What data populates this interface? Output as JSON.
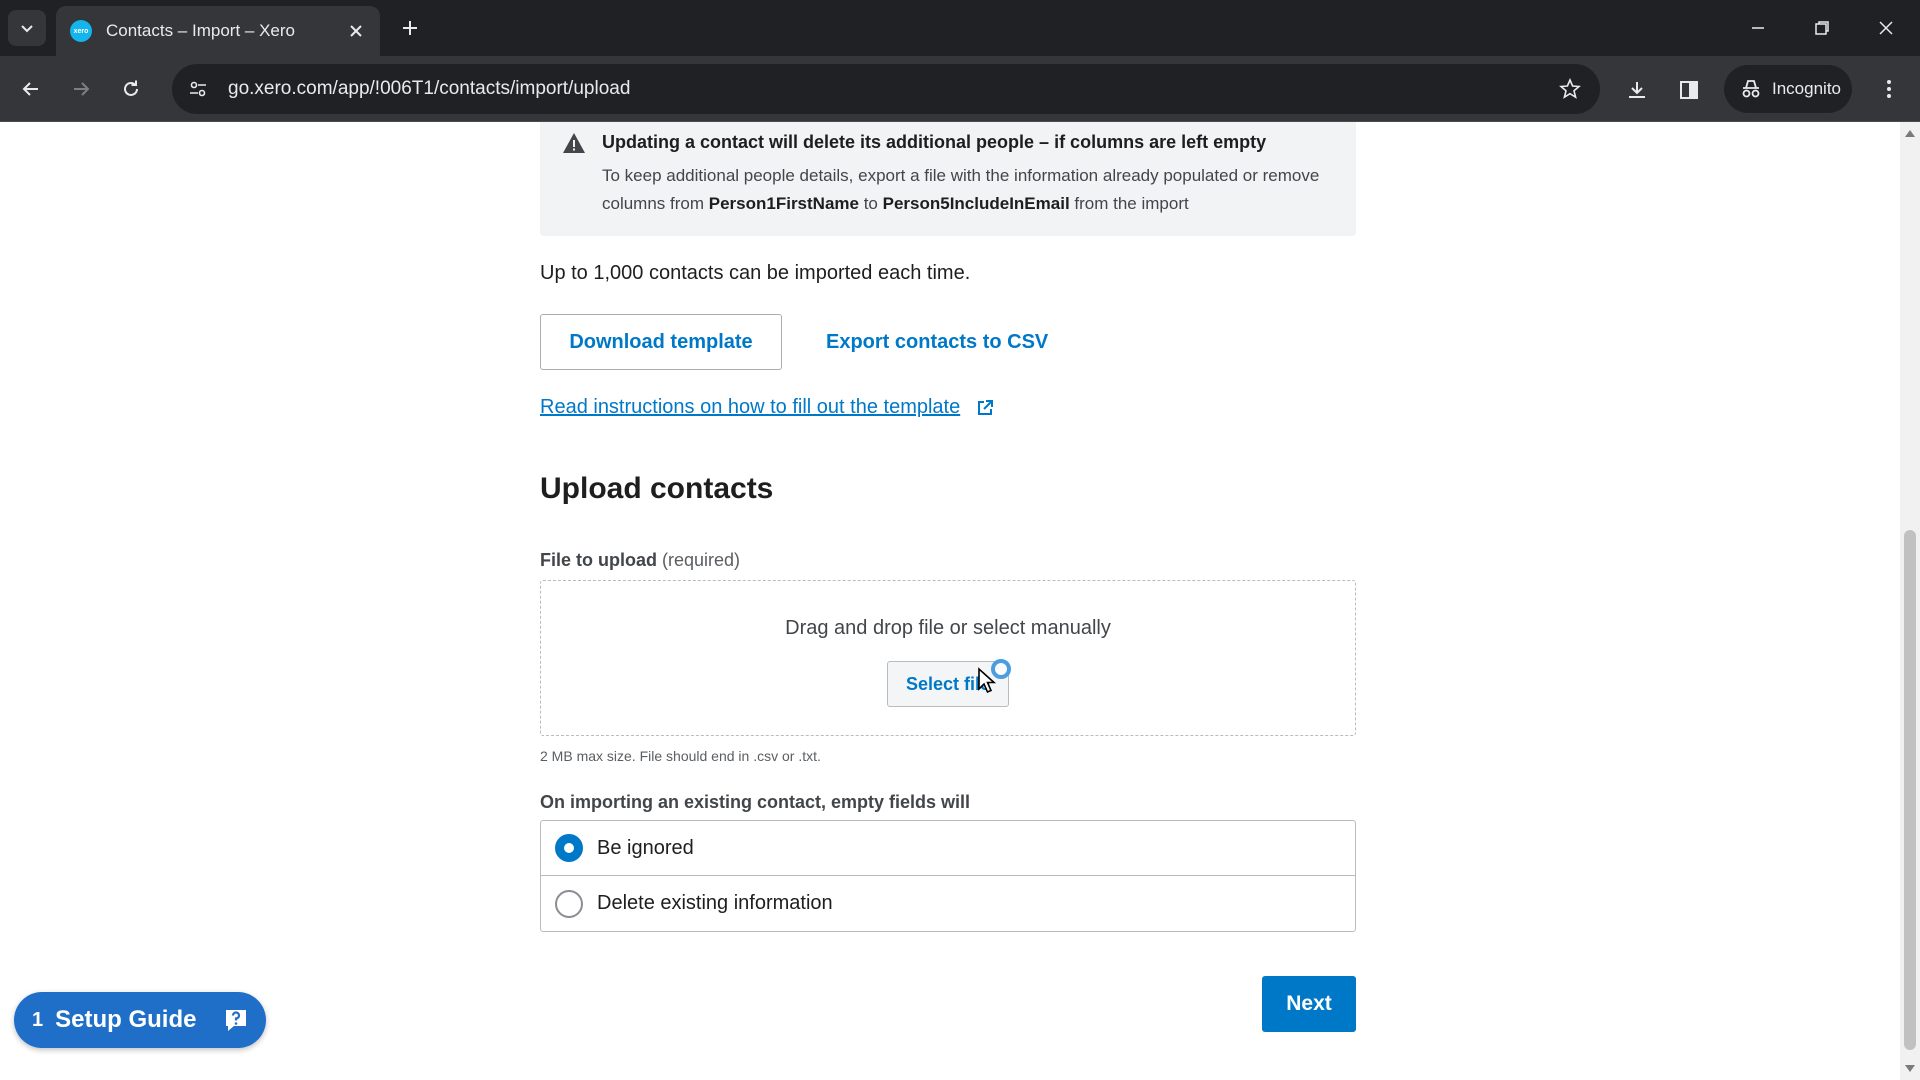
{
  "browser": {
    "tab_title": "Contacts – Import – Xero",
    "favicon_text": "xero",
    "url": "go.xero.com/app/!006T1/contacts/import/upload",
    "incognito_label": "Incognito"
  },
  "warning": {
    "title": "Updating a contact will delete its additional people – if columns are left empty",
    "body_part1": "To keep additional people details, export a file with the information already populated or remove columns from ",
    "field_start": "Person1FirstName",
    "body_part2": " to ",
    "field_end": "Person5IncludeInEmail",
    "body_part3": " from the import"
  },
  "limit_text": "Up to 1,000 contacts can be imported each time.",
  "actions": {
    "download_template": "Download template",
    "export_csv": "Export contacts to CSV",
    "instructions_link": "Read instructions on how to fill out the template"
  },
  "upload": {
    "section_title": "Upload contacts",
    "field_label": "File to upload",
    "field_required": "(required)",
    "drop_text": "Drag and drop file or select manually",
    "select_button": "Select file",
    "hint": "2 MB max size. File should end in .csv or .txt."
  },
  "empty_fields": {
    "label": "On importing an existing contact, empty fields will",
    "options": [
      {
        "label": "Be ignored",
        "selected": true
      },
      {
        "label": "Delete existing information",
        "selected": false
      }
    ]
  },
  "next_button": "Next",
  "setup_guide": {
    "count": "1",
    "label": "Setup Guide"
  },
  "colors": {
    "primary": "#0078c8",
    "setup_guide": "#1f6fc8"
  }
}
